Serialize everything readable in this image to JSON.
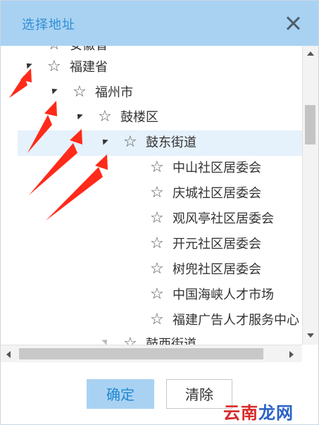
{
  "dialog": {
    "title": "选择地址",
    "close_icon": "close-icon",
    "accent_color": "#a9d2f2",
    "selected_row_color": "#e5f1fb"
  },
  "tree": {
    "partial_top": "安徽省",
    "nodes": [
      {
        "label": "福建省",
        "level": 0,
        "expanded": true
      },
      {
        "label": "福州市",
        "level": 1,
        "expanded": true
      },
      {
        "label": "鼓楼区",
        "level": 2,
        "expanded": true
      },
      {
        "label": "鼓东街道",
        "level": 3,
        "expanded": true,
        "selected": true
      },
      {
        "label": "中山社区居委会",
        "level": 4
      },
      {
        "label": "庆城社区居委会",
        "level": 4
      },
      {
        "label": "观风亭社区居委会",
        "level": 4
      },
      {
        "label": "开元社区居委会",
        "level": 4
      },
      {
        "label": "树兜社区居委会",
        "level": 4
      },
      {
        "label": "中国海峡人才市场",
        "level": 4
      },
      {
        "label": "福建广告人才服务中心",
        "level": 4
      },
      {
        "label": "鼓西街道",
        "level": 3,
        "expanded": false
      }
    ],
    "star_icon": "star-outline-icon",
    "annotation_color": "#ff2a1a"
  },
  "footer": {
    "ok_label": "确定",
    "clear_label": "清除"
  },
  "watermark": {
    "part1": "云",
    "part2": "南",
    "part3": "龙网"
  }
}
